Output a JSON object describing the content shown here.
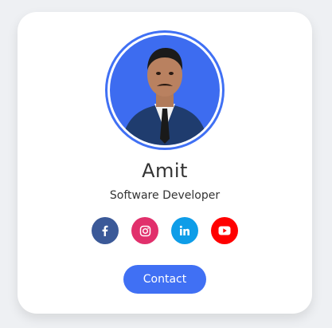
{
  "profile": {
    "name": "Amit",
    "role": "Software Developer"
  },
  "socials": [
    {
      "name": "facebook",
      "icon": "facebook-icon",
      "color": "#3b5998"
    },
    {
      "name": "instagram",
      "icon": "instagram-icon",
      "color": "#e1306c"
    },
    {
      "name": "linkedin",
      "icon": "linkedin-icon",
      "color": "#0e9de8"
    },
    {
      "name": "youtube",
      "icon": "youtube-icon",
      "color": "#ff0000"
    }
  ],
  "actions": {
    "contact_label": "Contact"
  },
  "colors": {
    "accent": "#4070f4",
    "avatar_bg": "#3d6cf0",
    "card_bg": "#ffffff",
    "page_bg": "#eef0f3"
  }
}
